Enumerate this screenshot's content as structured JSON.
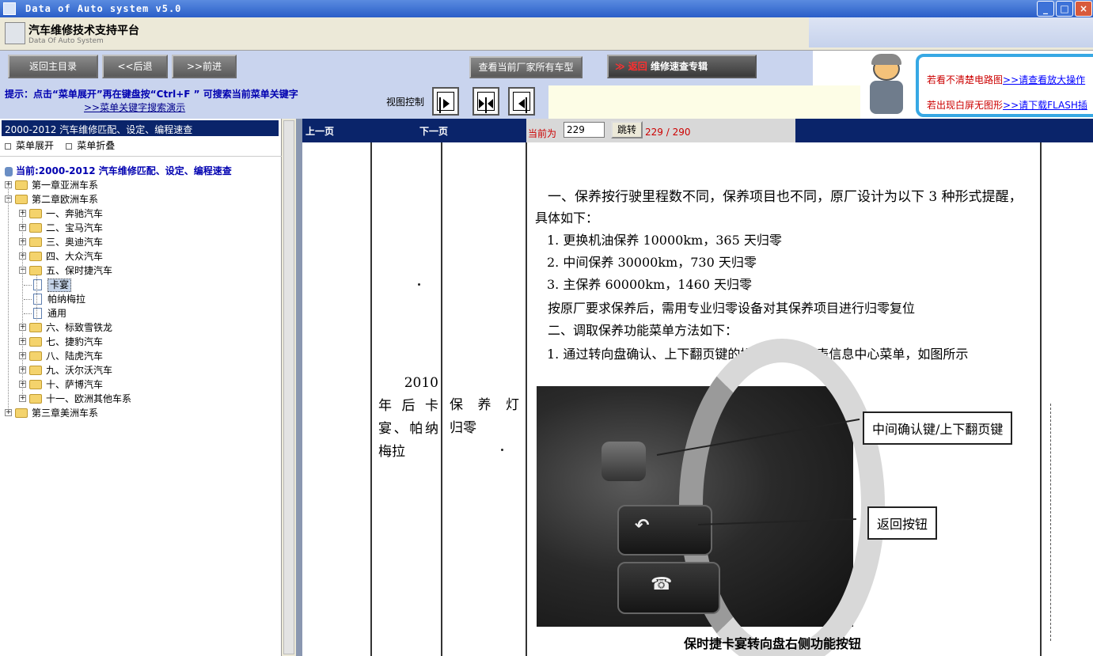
{
  "window": {
    "title": "Data of Auto system v5.0"
  },
  "header": {
    "app_name": "汽车维修技术支持平台",
    "app_subtitle": "Data Of Auto System"
  },
  "nav": {
    "back_main": "返回主目录",
    "back": "<<后退",
    "forward": ">>前进",
    "view_all_models": "查看当前厂家所有车型",
    "return_prefix": "返回",
    "return_label": "维修速查专辑"
  },
  "ad": {
    "line1_text": "看不清楚电路图",
    "line1_link": ">>请查看放大操作",
    "line2_text": "出现白屏无图形",
    "line2_link": ">>请下载FLASH插"
  },
  "tip": {
    "text": "提示：点击“菜单展开”再在键盘按“Ctrl+F ” 可搜索当前菜单关键字",
    "link": ">>菜单关键字搜索演示"
  },
  "view_control": {
    "label": "视图控制"
  },
  "sidebar": {
    "header": "2000-2012 汽车维修匹配、设定、编程速查",
    "expand": "菜单展开",
    "collapse": "菜单折叠",
    "current": "当前:2000-2012 汽车维修匹配、设定、编程速查",
    "tree": [
      {
        "label": "第一章亚洲车系",
        "level": 0,
        "type": "folder",
        "state": "collapsed"
      },
      {
        "label": "第二章欧洲车系",
        "level": 0,
        "type": "folder",
        "state": "expanded"
      },
      {
        "label": "一、奔驰汽车",
        "level": 1,
        "type": "folder",
        "state": "collapsed"
      },
      {
        "label": "二、宝马汽车",
        "level": 1,
        "type": "folder",
        "state": "collapsed"
      },
      {
        "label": "三、奥迪汽车",
        "level": 1,
        "type": "folder",
        "state": "collapsed"
      },
      {
        "label": "四、大众汽车",
        "level": 1,
        "type": "folder",
        "state": "collapsed"
      },
      {
        "label": "五、保时捷汽车",
        "level": 1,
        "type": "folder",
        "state": "expanded"
      },
      {
        "label": "卡宴",
        "level": 2,
        "type": "doc",
        "selected": true
      },
      {
        "label": "帕纳梅拉",
        "level": 2,
        "type": "doc"
      },
      {
        "label": "通用",
        "level": 2,
        "type": "doc"
      },
      {
        "label": "六、标致雪铁龙",
        "level": 1,
        "type": "folder",
        "state": "collapsed"
      },
      {
        "label": "七、捷豹汽车",
        "level": 1,
        "type": "folder",
        "state": "collapsed"
      },
      {
        "label": "八、陆虎汽车",
        "level": 1,
        "type": "folder",
        "state": "collapsed"
      },
      {
        "label": "九、沃尔沃汽车",
        "level": 1,
        "type": "folder",
        "state": "collapsed"
      },
      {
        "label": "十、萨博汽车",
        "level": 1,
        "type": "folder",
        "state": "collapsed"
      },
      {
        "label": "十一、欧洲其他车系",
        "level": 1,
        "type": "folder",
        "state": "collapsed"
      },
      {
        "label": "第三章美洲车系",
        "level": 0,
        "type": "folder",
        "state": "collapsed"
      }
    ]
  },
  "pager": {
    "prev": "上一页",
    "next": "下一页",
    "current_label": "当前为",
    "current_page": "229",
    "jump": "跳转",
    "page_count": "229 / 290"
  },
  "document": {
    "col1_lines": [
      "2010",
      "年后卡",
      "宴、帕纳",
      "梅拉"
    ],
    "col2_lines": [
      "保养灯",
      "归零"
    ],
    "paragraphs": [
      "一、保养按行驶里程数不同，保养项目也不同，原厂设计为以下 3 种形式提醒，",
      "具体如下：",
      "1. 更换机油保养 10000km，365 天归零",
      "2. 中间保养 30000km，730 天归零",
      "3. 主保养 60000km，1460 天归零",
      "按原厂要求保养后，需用专业归零设备对其保养项目进行归零复位",
      "二、调取保养功能菜单方法如下：",
      "1. 通过转向盘确认、上下翻页键的操作，调出仪表信息中心菜单，如图所示"
    ],
    "callout1": "中间确认键/上下翻页键",
    "callout2": "返回按钮",
    "caption": "保时捷卡宴转向盘右侧功能按钮"
  },
  "colors": {
    "navy": "#0a246a",
    "nav_bg": "#c9d4ee",
    "red": "#cc0000",
    "ad_border": "#37a8e4"
  }
}
